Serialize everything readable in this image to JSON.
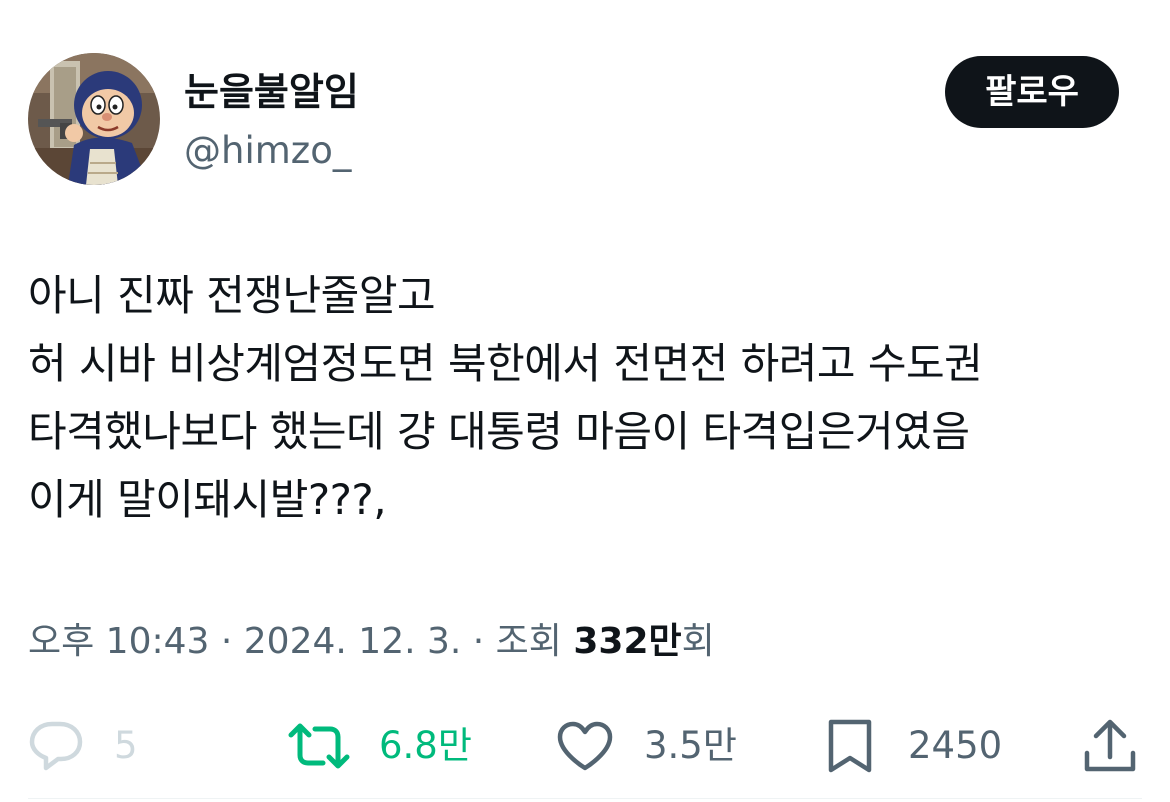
{
  "author": {
    "display_name": "눈을불알임",
    "handle": "@himzo_"
  },
  "follow_button_label": "팔로우",
  "tweet_lines": [
    "아니 진짜 전쟁난줄알고",
    "허 시바 비상계엄정도면 북한에서 전면전 하려고 수도권",
    "타격했나보다 했는데 걍 대통령 마음이 타격입은거였음",
    "이게 말이돼시발???,"
  ],
  "meta": {
    "time": "오후 10:43",
    "sep1": " · ",
    "date": "2024. 12. 3.",
    "sep2": " · ",
    "views_label": "조회 ",
    "views_count": "332만",
    "views_suffix": "회"
  },
  "actions": {
    "reply_count": "5",
    "retweet_count": "6.8만",
    "like_count": "3.5만",
    "bookmark_count": "2450"
  },
  "colors": {
    "retweet_green": "#00ba7c",
    "follow_button_bg": "#0f1419",
    "secondary_text": "#536471"
  },
  "icons": [
    "reply-icon",
    "retweet-icon",
    "like-icon",
    "bookmark-icon",
    "share-icon"
  ]
}
